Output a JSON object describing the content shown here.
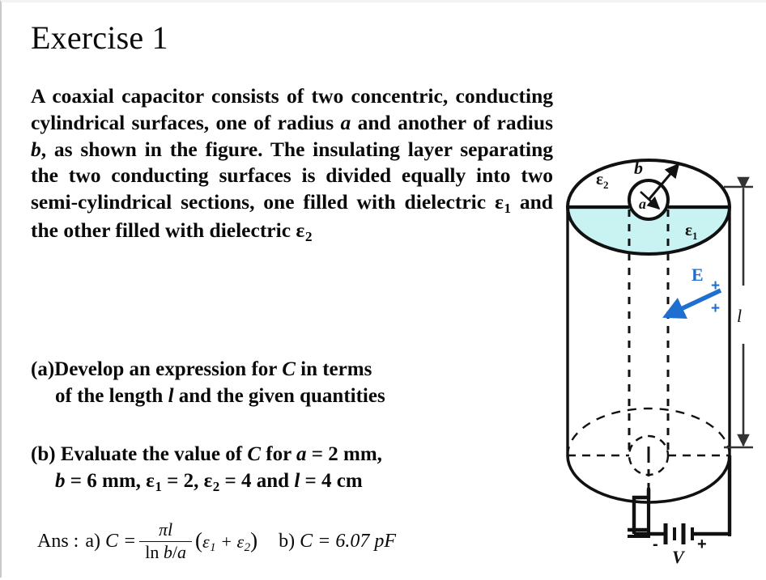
{
  "slide": {
    "title": "Exercise 1",
    "problem_statement": "A coaxial capacitor consists of two concentric, conducting cylindrical surfaces, one of radius a and another of radius b, as shown in the figure. The insulating layer separating the two conducting surfaces is divided equally into two semi-cylindrical sections, one filled with dielectric ε1 and the other filled with dielectric ε2",
    "question_a": {
      "label": "(a)",
      "line1": "Develop an expression for C in terms",
      "line2": "of the length l and the given quantities"
    },
    "question_b": {
      "label": "(b)",
      "line1": "Evaluate the value of C for a = 2 mm,",
      "line2": "b = 6 mm, ε1 = 2, ε2 = 4 and l = 4 cm"
    },
    "answer": {
      "lead": "Ans :",
      "part_a_label": "a)",
      "part_a_lhs": "C =",
      "fraction_numerator": "πl",
      "fraction_denominator": "ln b/a",
      "part_a_factor": "(ε1 + ε2)",
      "part_b_label": "b)",
      "part_b_value": "C = 6.07 pF"
    },
    "given_values": {
      "a": "2 mm",
      "b": "6 mm",
      "epsilon_1": "2",
      "epsilon_2": "4",
      "l": "4 cm",
      "capacitance": "6.07 pF"
    },
    "figure": {
      "caption_labels": {
        "outer_radius": "b",
        "inner_radius": "a",
        "dielectric_1": "ε",
        "dielectric_1_sub": "1",
        "dielectric_2": "ε",
        "dielectric_2_sub": "2",
        "field": "E",
        "length": "l",
        "voltage": "V",
        "plus_sign": "+",
        "minus_sign": "-",
        "charge_plus_upper": "+",
        "charge_plus_lower": "+"
      },
      "colors": {
        "dielectric_fill": "#c9f2f2",
        "field_blue": "#1f6fd0",
        "outline": "#111111"
      }
    }
  }
}
